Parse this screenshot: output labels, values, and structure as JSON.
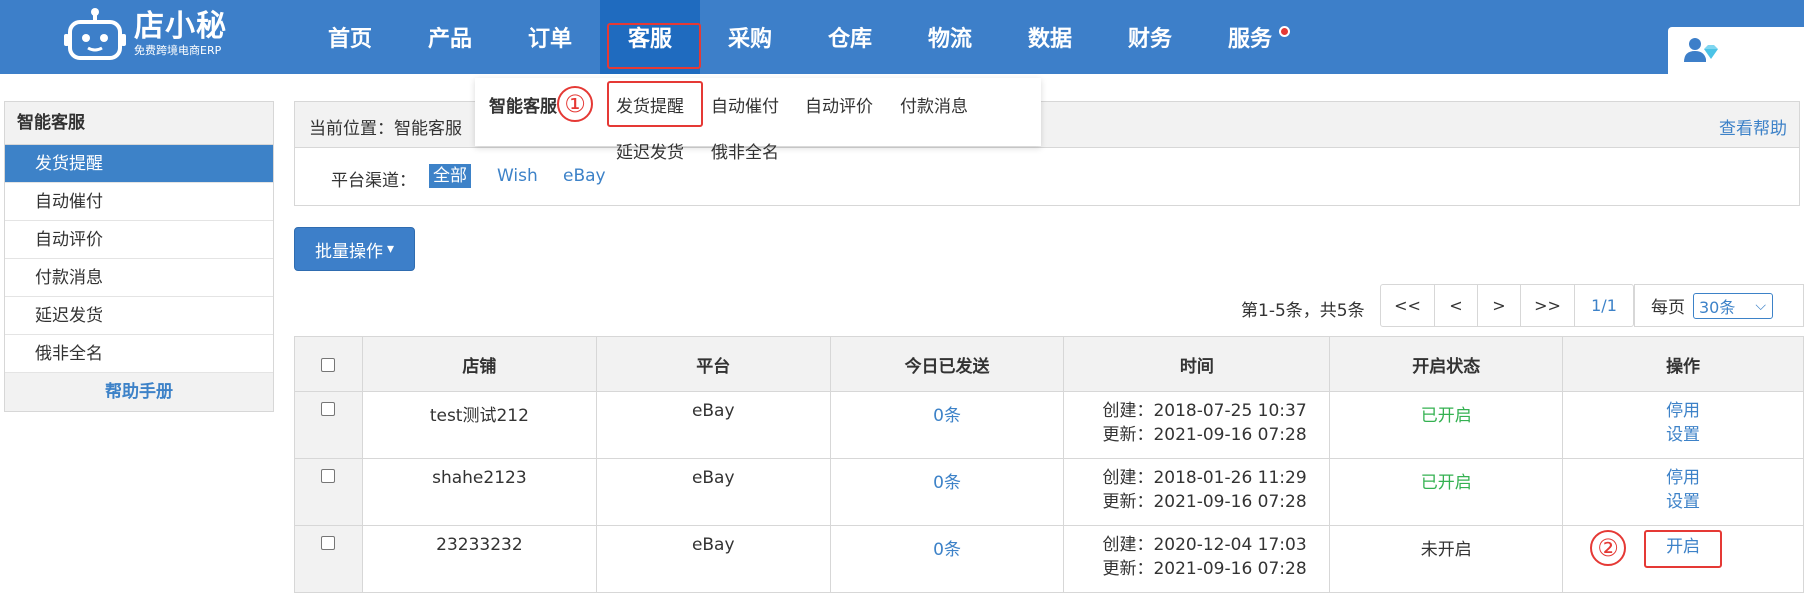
{
  "logo": {
    "title": "店小秘",
    "subtitle": "免费跨境电商ERP"
  },
  "nav": {
    "items": [
      {
        "label": "首页"
      },
      {
        "label": "产品"
      },
      {
        "label": "订单"
      },
      {
        "label": "客服"
      },
      {
        "label": "采购"
      },
      {
        "label": "仓库"
      },
      {
        "label": "物流"
      },
      {
        "label": "数据"
      },
      {
        "label": "财务"
      },
      {
        "label": "服务"
      }
    ],
    "active_index": 3
  },
  "submenu": {
    "title": "智能客服",
    "items": [
      "发货提醒",
      "自动催付",
      "自动评价",
      "付款消息",
      "延迟发货",
      "俄非全名"
    ],
    "marker": "①"
  },
  "sidebar": {
    "title": "智能客服",
    "items": [
      "发货提醒",
      "自动催付",
      "自动评价",
      "付款消息",
      "延迟发货",
      "俄非全名"
    ],
    "help": "帮助手册"
  },
  "breadcrumb": {
    "text": "当前位置：智能客服",
    "help": "查看帮助"
  },
  "filter": {
    "label": "平台渠道：",
    "chips": [
      "全部",
      "Wish",
      "eBay"
    ]
  },
  "batch": {
    "label": "批量操作",
    "caret": "▾"
  },
  "pager": {
    "info": "第1-5条，共5条",
    "buttons": [
      "<<",
      "<",
      ">",
      ">>",
      "1/1"
    ],
    "per_page_label": "每页",
    "per_page_value": "30条",
    "caret": "⌵"
  },
  "table": {
    "headers": [
      "店铺",
      "平台",
      "今日已发送",
      "时间",
      "开启状态",
      "操作"
    ],
    "rows": [
      {
        "shop": "test测试212",
        "platform": "eBay",
        "sent": "0条",
        "created": "创建：2018-07-25 10:37",
        "updated": "更新：2021-09-16 07:28",
        "status": "已开启",
        "op1": "停用",
        "op2": "设置"
      },
      {
        "shop": "shahe2123",
        "platform": "eBay",
        "sent": "0条",
        "created": "创建：2018-01-26 11:29",
        "updated": "更新：2021-09-16 07:28",
        "status": "已开启",
        "op1": "停用",
        "op2": "设置"
      },
      {
        "shop": "23233232",
        "platform": "eBay",
        "sent": "0条",
        "created": "创建：2020-12-04 17:03",
        "updated": "更新：2021-09-16 07:28",
        "status": "未开启",
        "op1": "开启"
      }
    ],
    "marker": "②"
  },
  "colors": {
    "brand": "#3d7fc9",
    "link": "#3d82c8",
    "highlight": "#e53935",
    "green": "#34b151"
  }
}
